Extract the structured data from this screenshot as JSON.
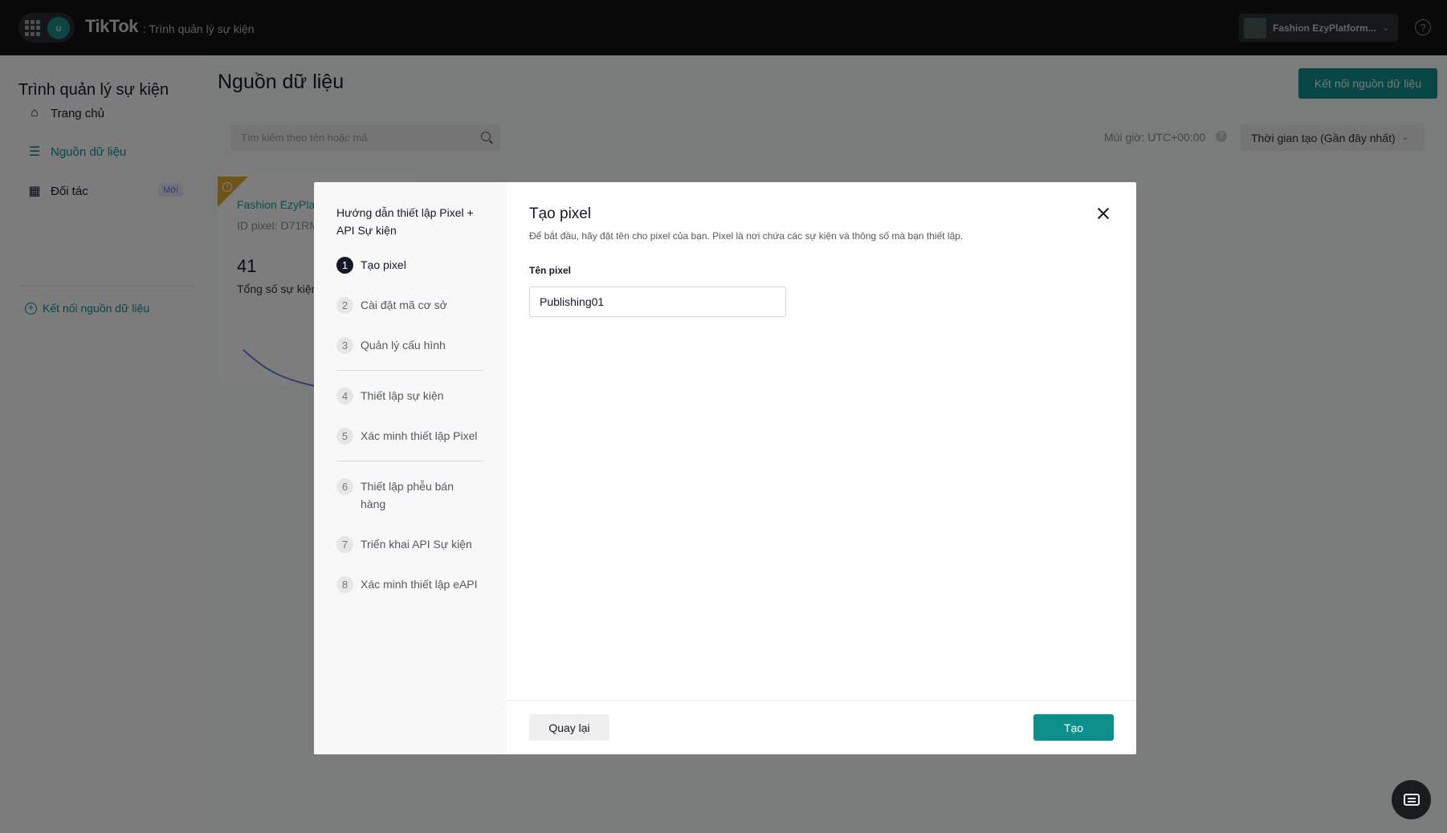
{
  "topbar": {
    "avatar_letter": "u",
    "brand": "TikTok",
    "brand_sub": ": Trình quản lý sự kiện",
    "account_name": "Fashion EzyPlatform...",
    "account_chevron": "chevron-down-icon",
    "help_icon": "question-circle-icon",
    "help_glyph": "?"
  },
  "sidebar": {
    "title": "Trình quản lý sự kiện",
    "items": [
      {
        "label": "Trang chủ",
        "icon": "home-icon",
        "glyph": "⌂"
      },
      {
        "label": "Nguồn dữ liệu",
        "icon": "list-icon",
        "glyph": "☰"
      },
      {
        "label": "Đối tác",
        "icon": "store-icon",
        "glyph": "▦",
        "badge": "Mới"
      }
    ],
    "connect_link": "Kết nối nguồn dữ liệu",
    "connect_glyph": "+"
  },
  "main": {
    "title": "Nguồn dữ liệu",
    "connect_button": "Kết nối nguồn dữ liệu",
    "search_placeholder": "Tìm kiếm theo tên hoặc mã",
    "timezone": "Múi giờ: UTC+00:00",
    "timezone_help": "?",
    "sort_label": "Thời gian tạo (Gần đây nhất)",
    "card": {
      "name": "Fashion EzyPla",
      "pixel_id": "ID pixel: D71RM",
      "total": "41",
      "total_label": "Tổng số sự kiện",
      "warning_glyph": "!"
    }
  },
  "modal": {
    "guide_title": "Hướng dẫn thiết lập Pixel + API Sự kiện",
    "steps": [
      {
        "num": "1",
        "label": "Tạo pixel"
      },
      {
        "num": "2",
        "label": "Cài đặt mã cơ sở"
      },
      {
        "num": "3",
        "label": "Quản lý cấu hình"
      },
      {
        "num": "4",
        "label": "Thiết lập sự kiện"
      },
      {
        "num": "5",
        "label": "Xác minh thiết lập Pixel"
      },
      {
        "num": "6",
        "label": "Thiết lập phễu bán hàng"
      },
      {
        "num": "7",
        "label": "Triển khai API Sự kiện"
      },
      {
        "num": "8",
        "label": "Xác minh thiết lập eAPI"
      }
    ],
    "active_step": 1,
    "title": "Tạo pixel",
    "description": "Để bắt đầu, hãy đặt tên cho pixel của bạn. Pixel là nơi chứa các sự kiện và thông số mà bạn thiết lập.",
    "field_label": "Tên pixel",
    "field_value": "Publishing01",
    "back_button": "Quay lại",
    "create_button": "Tạo"
  },
  "colors": {
    "accent": "#0e8f8c",
    "topbar": "#121212",
    "warning": "#e0a92a"
  }
}
